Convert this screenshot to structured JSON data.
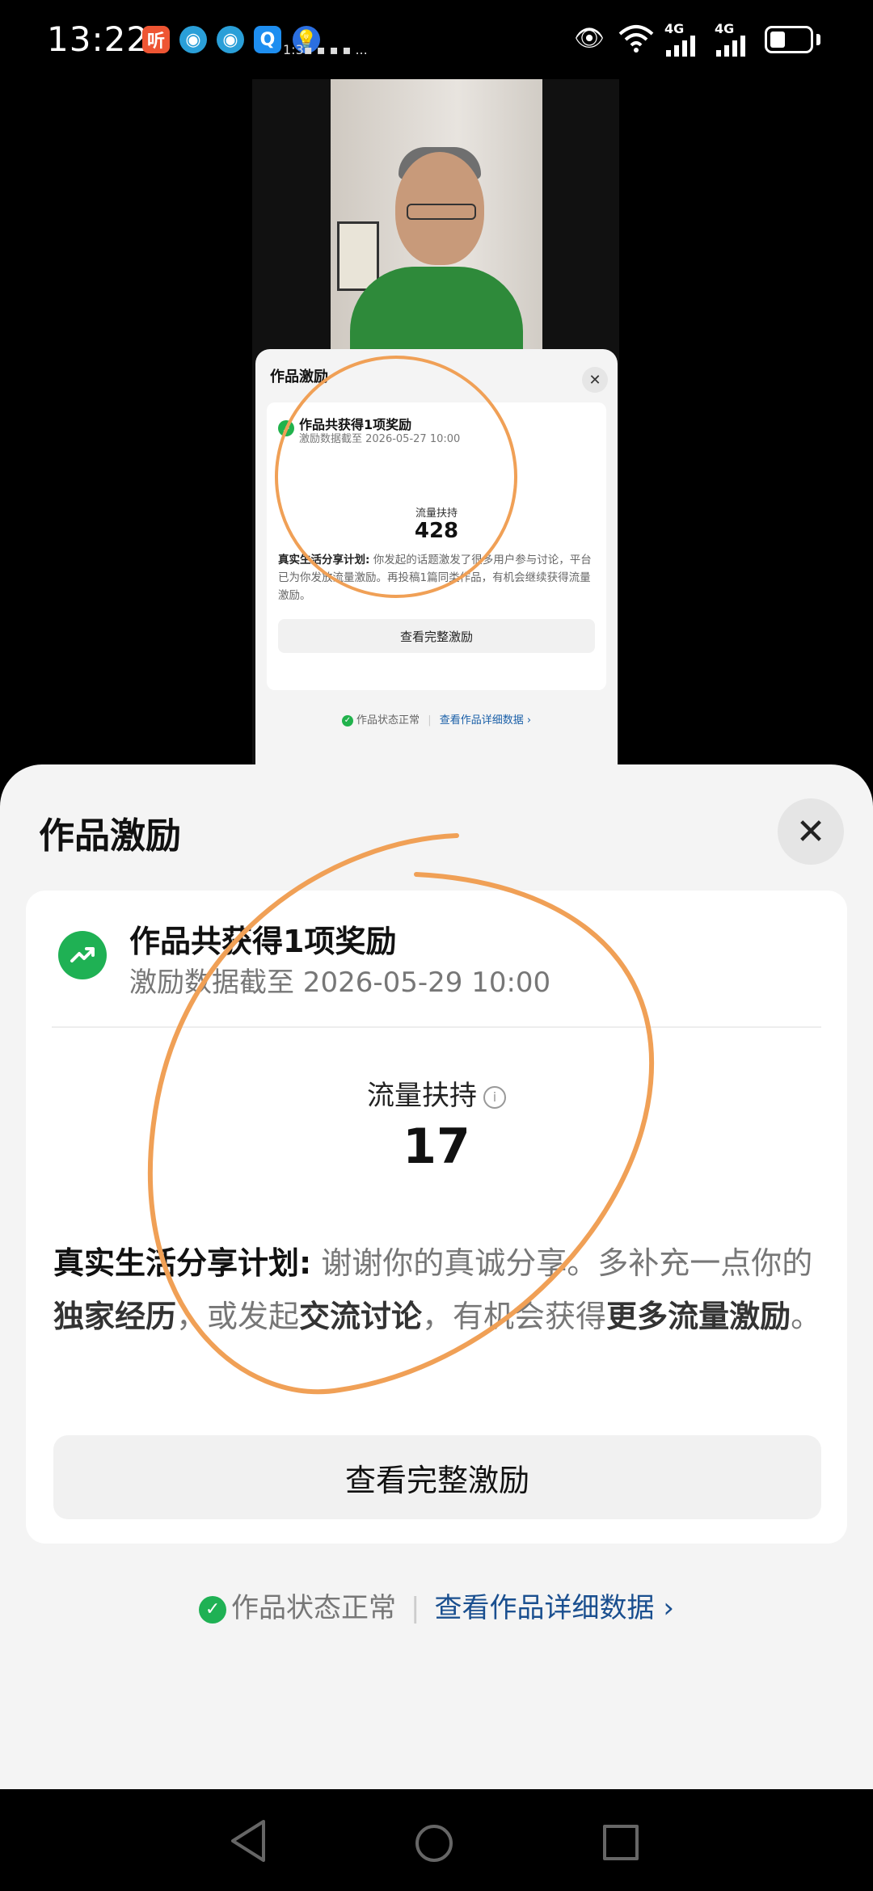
{
  "status_bar": {
    "time": "13:22",
    "app_icons": [
      "听",
      "◉",
      "◉",
      "Q",
      "💡"
    ],
    "tiny_text": "1:3▪ ▪ ▪ ▪ ...",
    "network": [
      "4G",
      "4G"
    ]
  },
  "preview": {
    "title": "作品激励",
    "close": "✕",
    "card_title": "作品共获得1项奖励",
    "card_subtitle": "激励数据截至 2026-05-27 10:00",
    "metric_label": "流量扶持",
    "metric_value": "428",
    "desc_bold": "真实生活分享计划:",
    "desc_text": "你发起的话题激发了很多用户参与讨论，平台已为你发放流量激励。再投稿1篇同类作品，有机会继续获得流量激励。",
    "button": "查看完整激励",
    "status": "作品状态正常",
    "link": "查看作品详细数据 ›"
  },
  "sheet": {
    "title": "作品激励",
    "close": "✕",
    "card_title": "作品共获得1项奖励",
    "card_subtitle": "激励数据截至 2026-05-29 10:00",
    "metric_label": "流量扶持",
    "metric_info": "i",
    "metric_value": "17",
    "desc_part1": "真实生活分享计划:",
    "desc_part2": " 谢谢你的真诚分享。多补充一点你的",
    "desc_part3": "独家经历",
    "desc_part4": "，或发起",
    "desc_part5": "交流讨论",
    "desc_part6": "，有机会获得",
    "desc_part7": "更多流量激励",
    "desc_part8": "。",
    "button": "查看完整激励",
    "status": "作品状态正常",
    "link": "查看作品详细数据",
    "link_arrow": "›"
  },
  "colors": {
    "accent_green": "#1fb154",
    "link_blue": "#1a4f8f",
    "annotation_orange": "#f0a056"
  },
  "icons": [
    "back-triangle-icon",
    "home-circle-icon",
    "recent-square-icon",
    "trending-up-icon",
    "info-icon",
    "check-icon",
    "close-icon"
  ]
}
